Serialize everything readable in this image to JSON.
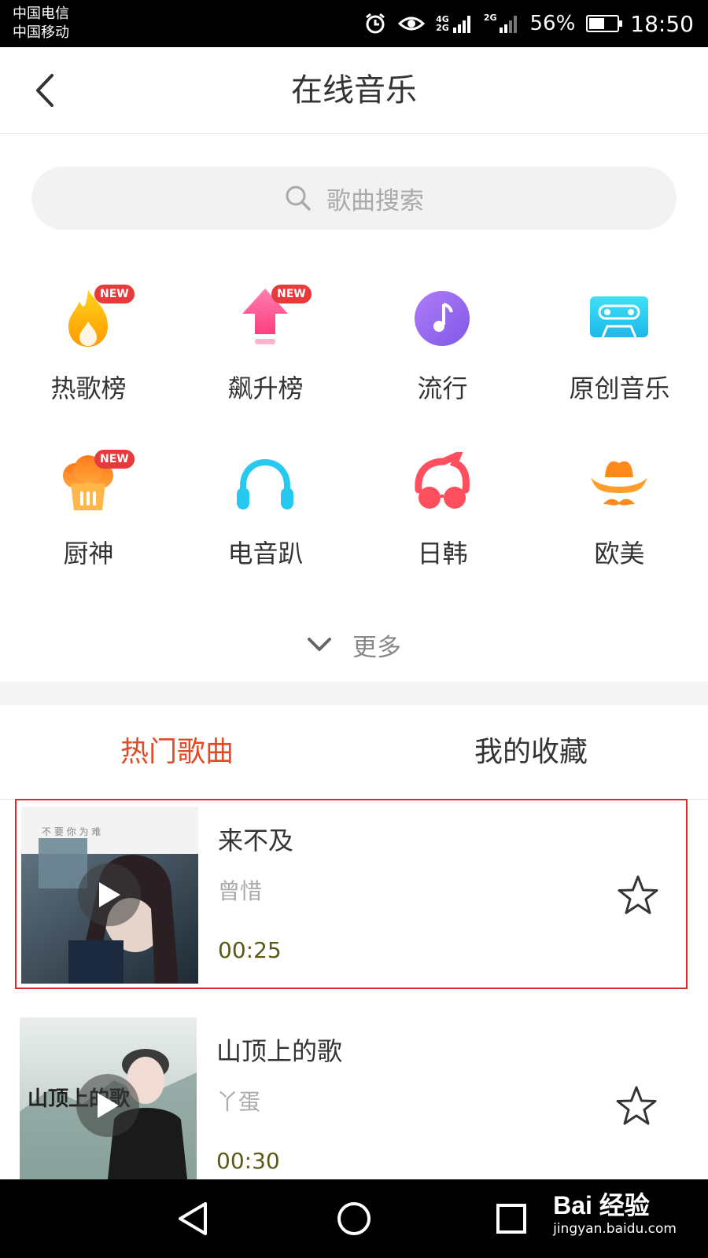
{
  "status_bar": {
    "carrier_1": "中国电信",
    "carrier_2": "中国移动",
    "sig1_top": "4G",
    "sig1_bottom": "2G",
    "sig2_label": "2G",
    "battery_pct": "56%",
    "battery_level": 0.56,
    "time": "18:50",
    "icons": [
      "alarm-icon",
      "eye-icon",
      "signal-icon",
      "battery-icon"
    ]
  },
  "header": {
    "title": "在线音乐",
    "back_icon": "chevron-left-icon"
  },
  "search": {
    "placeholder": "歌曲搜索",
    "icon": "search-icon"
  },
  "categories": [
    {
      "label": "热歌榜",
      "icon": "flame-icon",
      "badge": "NEW",
      "color": "#ffb400"
    },
    {
      "label": "飙升榜",
      "icon": "arrow-up-icon",
      "badge": "NEW",
      "color": "#ff4f8b"
    },
    {
      "label": "流行",
      "icon": "music-note-icon",
      "badge": "",
      "color": "#9b6cf0"
    },
    {
      "label": "原创音乐",
      "icon": "cassette-icon",
      "badge": "",
      "color": "#2fd0f0"
    },
    {
      "label": "厨神",
      "icon": "chef-hat-icon",
      "badge": "NEW",
      "color": "#ff8a1c"
    },
    {
      "label": "电音趴",
      "icon": "headphones-icon",
      "badge": "",
      "color": "#27c9f0"
    },
    {
      "label": "日韩",
      "icon": "glasses-icon",
      "badge": "",
      "color": "#ff4f5f"
    },
    {
      "label": "欧美",
      "icon": "cowboy-hat-icon",
      "badge": "",
      "color": "#ff8a1c"
    }
  ],
  "more": {
    "label": "更多",
    "icon": "chevron-down-icon"
  },
  "tabs": [
    {
      "label": "热门歌曲",
      "active": true
    },
    {
      "label": "我的收藏",
      "active": false
    }
  ],
  "songs": [
    {
      "title": "来不及",
      "artist": "曾惜",
      "duration": "00:25",
      "cover_text": "不 要 你 为 难"
    },
    {
      "title": "山顶上的歌",
      "artist": "丫蛋",
      "duration": "00:30",
      "cover_text": "山顶上的歌"
    }
  ],
  "nav": {
    "back_icon": "triangle-back-icon",
    "home_icon": "circle-home-icon",
    "recent_icon": "square-recent-icon"
  },
  "watermark": {
    "line1": "Bai 经验",
    "line2": "jingyan.baidu.com"
  },
  "colors": {
    "accent": "#e24a28",
    "highlight_border": "#d92b2b",
    "duration_text": "#5a5a18"
  }
}
